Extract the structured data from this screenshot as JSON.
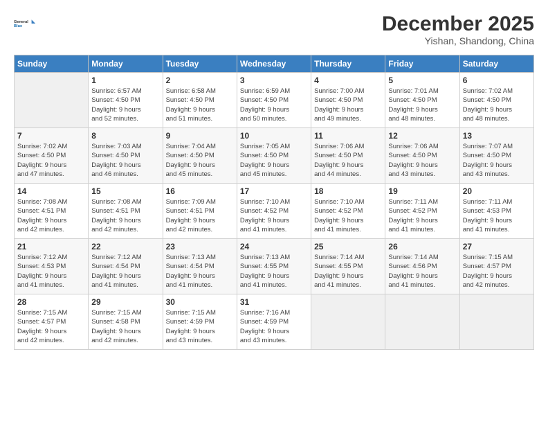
{
  "logo": {
    "line1": "General",
    "line2": "Blue"
  },
  "title": "December 2025",
  "subtitle": "Yishan, Shandong, China",
  "days_of_week": [
    "Sunday",
    "Monday",
    "Tuesday",
    "Wednesday",
    "Thursday",
    "Friday",
    "Saturday"
  ],
  "weeks": [
    [
      {
        "day": "",
        "info": ""
      },
      {
        "day": "1",
        "info": "Sunrise: 6:57 AM\nSunset: 4:50 PM\nDaylight: 9 hours\nand 52 minutes."
      },
      {
        "day": "2",
        "info": "Sunrise: 6:58 AM\nSunset: 4:50 PM\nDaylight: 9 hours\nand 51 minutes."
      },
      {
        "day": "3",
        "info": "Sunrise: 6:59 AM\nSunset: 4:50 PM\nDaylight: 9 hours\nand 50 minutes."
      },
      {
        "day": "4",
        "info": "Sunrise: 7:00 AM\nSunset: 4:50 PM\nDaylight: 9 hours\nand 49 minutes."
      },
      {
        "day": "5",
        "info": "Sunrise: 7:01 AM\nSunset: 4:50 PM\nDaylight: 9 hours\nand 48 minutes."
      },
      {
        "day": "6",
        "info": "Sunrise: 7:02 AM\nSunset: 4:50 PM\nDaylight: 9 hours\nand 48 minutes."
      }
    ],
    [
      {
        "day": "7",
        "info": "Sunrise: 7:02 AM\nSunset: 4:50 PM\nDaylight: 9 hours\nand 47 minutes."
      },
      {
        "day": "8",
        "info": "Sunrise: 7:03 AM\nSunset: 4:50 PM\nDaylight: 9 hours\nand 46 minutes."
      },
      {
        "day": "9",
        "info": "Sunrise: 7:04 AM\nSunset: 4:50 PM\nDaylight: 9 hours\nand 45 minutes."
      },
      {
        "day": "10",
        "info": "Sunrise: 7:05 AM\nSunset: 4:50 PM\nDaylight: 9 hours\nand 45 minutes."
      },
      {
        "day": "11",
        "info": "Sunrise: 7:06 AM\nSunset: 4:50 PM\nDaylight: 9 hours\nand 44 minutes."
      },
      {
        "day": "12",
        "info": "Sunrise: 7:06 AM\nSunset: 4:50 PM\nDaylight: 9 hours\nand 43 minutes."
      },
      {
        "day": "13",
        "info": "Sunrise: 7:07 AM\nSunset: 4:50 PM\nDaylight: 9 hours\nand 43 minutes."
      }
    ],
    [
      {
        "day": "14",
        "info": "Sunrise: 7:08 AM\nSunset: 4:51 PM\nDaylight: 9 hours\nand 42 minutes."
      },
      {
        "day": "15",
        "info": "Sunrise: 7:08 AM\nSunset: 4:51 PM\nDaylight: 9 hours\nand 42 minutes."
      },
      {
        "day": "16",
        "info": "Sunrise: 7:09 AM\nSunset: 4:51 PM\nDaylight: 9 hours\nand 42 minutes."
      },
      {
        "day": "17",
        "info": "Sunrise: 7:10 AM\nSunset: 4:52 PM\nDaylight: 9 hours\nand 41 minutes."
      },
      {
        "day": "18",
        "info": "Sunrise: 7:10 AM\nSunset: 4:52 PM\nDaylight: 9 hours\nand 41 minutes."
      },
      {
        "day": "19",
        "info": "Sunrise: 7:11 AM\nSunset: 4:52 PM\nDaylight: 9 hours\nand 41 minutes."
      },
      {
        "day": "20",
        "info": "Sunrise: 7:11 AM\nSunset: 4:53 PM\nDaylight: 9 hours\nand 41 minutes."
      }
    ],
    [
      {
        "day": "21",
        "info": "Sunrise: 7:12 AM\nSunset: 4:53 PM\nDaylight: 9 hours\nand 41 minutes."
      },
      {
        "day": "22",
        "info": "Sunrise: 7:12 AM\nSunset: 4:54 PM\nDaylight: 9 hours\nand 41 minutes."
      },
      {
        "day": "23",
        "info": "Sunrise: 7:13 AM\nSunset: 4:54 PM\nDaylight: 9 hours\nand 41 minutes."
      },
      {
        "day": "24",
        "info": "Sunrise: 7:13 AM\nSunset: 4:55 PM\nDaylight: 9 hours\nand 41 minutes."
      },
      {
        "day": "25",
        "info": "Sunrise: 7:14 AM\nSunset: 4:55 PM\nDaylight: 9 hours\nand 41 minutes."
      },
      {
        "day": "26",
        "info": "Sunrise: 7:14 AM\nSunset: 4:56 PM\nDaylight: 9 hours\nand 41 minutes."
      },
      {
        "day": "27",
        "info": "Sunrise: 7:15 AM\nSunset: 4:57 PM\nDaylight: 9 hours\nand 42 minutes."
      }
    ],
    [
      {
        "day": "28",
        "info": "Sunrise: 7:15 AM\nSunset: 4:57 PM\nDaylight: 9 hours\nand 42 minutes."
      },
      {
        "day": "29",
        "info": "Sunrise: 7:15 AM\nSunset: 4:58 PM\nDaylight: 9 hours\nand 42 minutes."
      },
      {
        "day": "30",
        "info": "Sunrise: 7:15 AM\nSunset: 4:59 PM\nDaylight: 9 hours\nand 43 minutes."
      },
      {
        "day": "31",
        "info": "Sunrise: 7:16 AM\nSunset: 4:59 PM\nDaylight: 9 hours\nand 43 minutes."
      },
      {
        "day": "",
        "info": ""
      },
      {
        "day": "",
        "info": ""
      },
      {
        "day": "",
        "info": ""
      }
    ]
  ]
}
